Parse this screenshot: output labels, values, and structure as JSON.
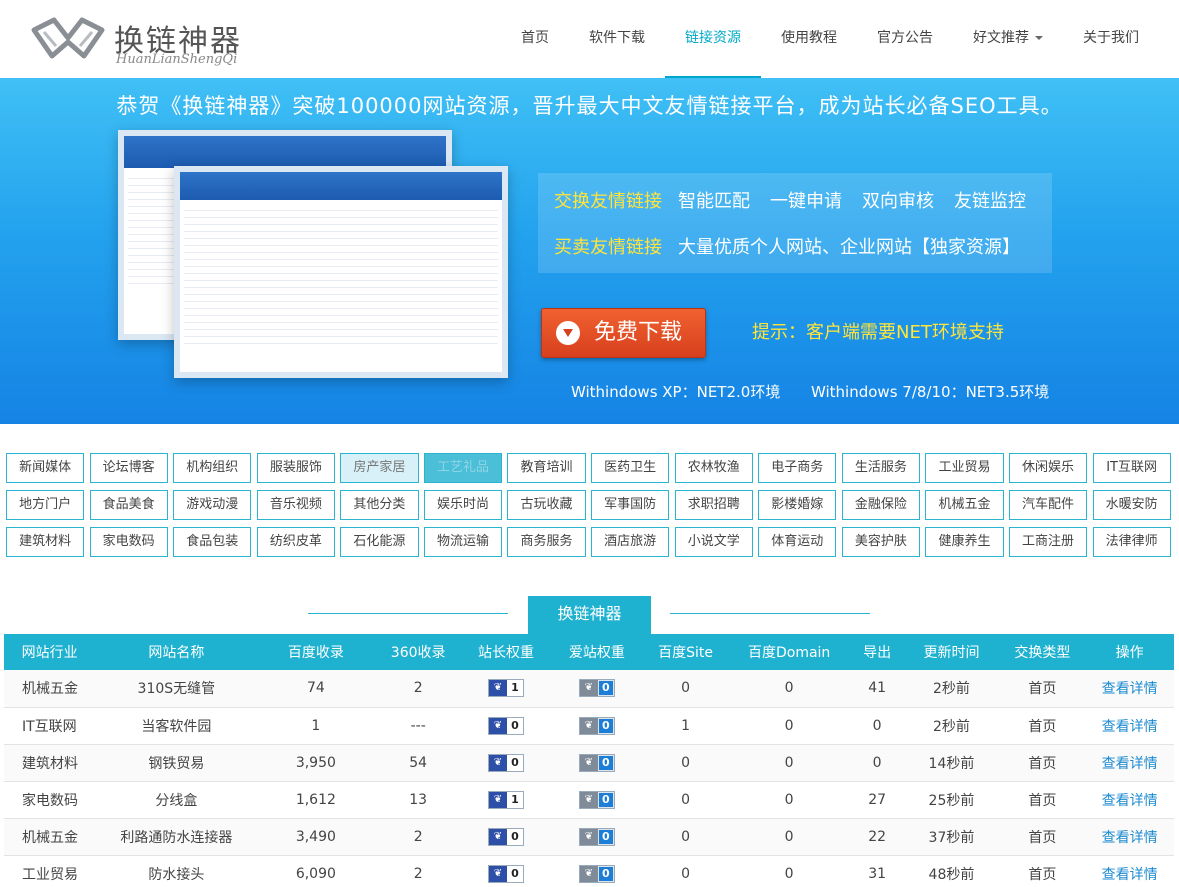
{
  "logo": {
    "title": "换链神器",
    "subtitle": "HuanLianShengQi"
  },
  "nav": [
    {
      "label": "首页"
    },
    {
      "label": "软件下载"
    },
    {
      "label": "链接资源",
      "active": true
    },
    {
      "label": "使用教程"
    },
    {
      "label": "官方公告"
    },
    {
      "label": "好文推荐",
      "dropdown": true
    },
    {
      "label": "关于我们"
    }
  ],
  "banner": {
    "title": "恭贺《换链神器》突破100000网站资源，晋升最大中文友情链接平台，成为站长必备SEO工具。",
    "line1_highlight": "交换友情链接",
    "line1_items": [
      "智能匹配",
      "一键申请",
      "双向审核",
      "友链监控"
    ],
    "line2_highlight": "买卖友情链接",
    "line2_text": "大量优质个人网站、企业网站【独家资源】",
    "download_label": "免费下载",
    "tip": "提示：客户端需要NET环境支持",
    "env_xp": "Withindows XP：NET2.0环境",
    "env_7": "Withindows 7/8/10：NET3.5环境"
  },
  "categories": [
    "新闻媒体",
    "论坛博客",
    "机构组织",
    "服装服饰",
    "房产家居",
    "工艺礼品",
    "教育培训",
    "医药卫生",
    "农林牧渔",
    "电子商务",
    "生活服务",
    "工业贸易",
    "休闲娱乐",
    "IT互联网",
    "地方门户",
    "食品美食",
    "游戏动漫",
    "音乐视频",
    "其他分类",
    "娱乐时尚",
    "古玩收藏",
    "军事国防",
    "求职招聘",
    "影楼婚嫁",
    "金融保险",
    "机械五金",
    "汽车配件",
    "水暖安防",
    "建筑材料",
    "家电数码",
    "食品包装",
    "纺织皮革",
    "石化能源",
    "物流运输",
    "商务服务",
    "酒店旅游",
    "小说文学",
    "体育运动",
    "美容护肤",
    "健康养生",
    "工商注册",
    "法律律师"
  ],
  "section_title": "换链神器",
  "table": {
    "headers": [
      "网站行业",
      "网站名称",
      "百度收录",
      "360收录",
      "站长权重",
      "爱站权重",
      "百度Site",
      "百度Domain",
      "导出",
      "更新时间",
      "交换类型",
      "操作"
    ],
    "rows": [
      {
        "industry": "机械五金",
        "name": "310S无缝管",
        "baidu": "74",
        "s360": "2",
        "zz": "1",
        "az": "0",
        "site": "0",
        "domain": "0",
        "out": "41",
        "time": "2秒前",
        "type": "首页",
        "action": "查看详情"
      },
      {
        "industry": "IT互联网",
        "name": "当客软件园",
        "baidu": "1",
        "s360": "---",
        "zz": "0",
        "az": "0",
        "site": "1",
        "domain": "0",
        "out": "0",
        "time": "2秒前",
        "type": "首页",
        "action": "查看详情"
      },
      {
        "industry": "建筑材料",
        "name": "钢铁贸易",
        "baidu": "3,950",
        "s360": "54",
        "zz": "0",
        "az": "0",
        "site": "0",
        "domain": "0",
        "out": "0",
        "time": "14秒前",
        "type": "首页",
        "action": "查看详情"
      },
      {
        "industry": "家电数码",
        "name": "分线盒",
        "baidu": "1,612",
        "s360": "13",
        "zz": "1",
        "az": "0",
        "site": "0",
        "domain": "0",
        "out": "27",
        "time": "25秒前",
        "type": "首页",
        "action": "查看详情"
      },
      {
        "industry": "机械五金",
        "name": "利路通防水连接器",
        "baidu": "3,490",
        "s360": "2",
        "zz": "0",
        "az": "0",
        "site": "0",
        "domain": "0",
        "out": "22",
        "time": "37秒前",
        "type": "首页",
        "action": "查看详情"
      },
      {
        "industry": "工业贸易",
        "name": "防水接头",
        "baidu": "6,090",
        "s360": "2",
        "zz": "0",
        "az": "0",
        "site": "0",
        "domain": "0",
        "out": "31",
        "time": "48秒前",
        "type": "首页",
        "action": "查看详情"
      }
    ]
  },
  "colors": {
    "accent": "#1fb2d0",
    "banner": "#23a2ee",
    "highlight": "#ffe43a",
    "download": "#e5502a"
  }
}
